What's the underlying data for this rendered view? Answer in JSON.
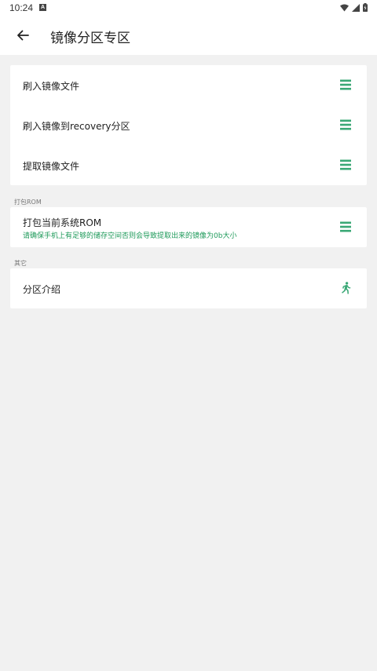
{
  "status_bar": {
    "time": "10:24",
    "badge": "A"
  },
  "app_bar": {
    "title": "镜像分区专区"
  },
  "colors": {
    "accent": "#1e9a5a",
    "icon_green": "#3aa876",
    "background": "#f1f1f1"
  },
  "group1": {
    "items": [
      {
        "label": "刷入镜像文件",
        "icon": "menu-icon"
      },
      {
        "label": "刷入镜像到recovery分区",
        "icon": "menu-icon"
      },
      {
        "label": "提取镜像文件",
        "icon": "menu-icon"
      }
    ]
  },
  "group2": {
    "header": "打包ROM",
    "items": [
      {
        "label": "打包当前系统ROM",
        "sub": "请确保手机上有足够的储存空间否则会导致提取出来的镜像为0b大小",
        "icon": "menu-icon"
      }
    ]
  },
  "group3": {
    "header": "其它",
    "items": [
      {
        "label": "分区介绍",
        "icon": "running-person-icon"
      }
    ]
  }
}
